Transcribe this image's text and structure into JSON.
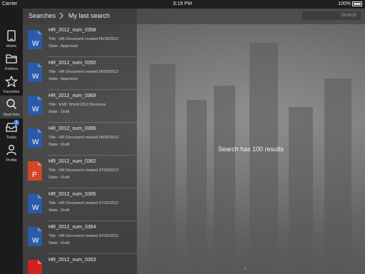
{
  "status_bar": {
    "carrier": "Carrier",
    "time": "6:19 PM",
    "battery": "100%"
  },
  "header": {
    "breadcrumb_root": "Searches",
    "breadcrumb_current": "My last search",
    "search_placeholder": "Search"
  },
  "sidebar": {
    "items": [
      {
        "label": "Home",
        "icon": "home-icon",
        "active": false
      },
      {
        "label": "Folders",
        "icon": "folder-icon",
        "active": false
      },
      {
        "label": "Favorites",
        "icon": "star-icon",
        "active": false
      },
      {
        "label": "Searches",
        "icon": "search-icon",
        "active": true
      },
      {
        "label": "Tasks",
        "icon": "inbox-icon",
        "badge": "5",
        "active": false
      },
      {
        "label": "Profile",
        "icon": "profile-icon",
        "active": false
      }
    ]
  },
  "documents": [
    {
      "name": "HR_2012_num_0358",
      "title": "Title : HR Document created 05/18/2012",
      "state": "State : Approved",
      "type": "W",
      "color": "#2b5aa8"
    },
    {
      "name": "HR_2012_num_0350",
      "title": "Title : HR Document created 05/09/2012",
      "state": "State : Approved",
      "type": "W",
      "color": "#2b5aa8"
    },
    {
      "name": "HR_2012_num_0369",
      "title": "Title : EMC World 2012 Brochure",
      "state": "State : Draft",
      "type": "W",
      "color": "#2b5aa8"
    },
    {
      "name": "HR_2012_num_0366",
      "title": "Title : HR Document created 08/06/2012",
      "state": "State : Draft",
      "type": "W",
      "color": "#2b5aa8"
    },
    {
      "name": "HR_2012_num_0362",
      "title": "Title : HR Document created 07/03/2012",
      "state": "State : Draft",
      "type": "P",
      "color": "#d24726"
    },
    {
      "name": "HR_2012_num_0365",
      "title": "Title : HR Document created 07/10/2012",
      "state": "State : Draft",
      "type": "W",
      "color": "#2b5aa8"
    },
    {
      "name": "HR_2012_num_0364",
      "title": "Title : HR Document created 07/10/2012",
      "state": "State : Draft",
      "type": "W",
      "color": "#2b5aa8"
    },
    {
      "name": "HR_2012_num_0353",
      "title": "",
      "state": "",
      "type": "",
      "color": "#d02020"
    }
  ],
  "results_text": "Search has 100 results",
  "page_indicator": {
    "count": 2,
    "active": 0
  }
}
